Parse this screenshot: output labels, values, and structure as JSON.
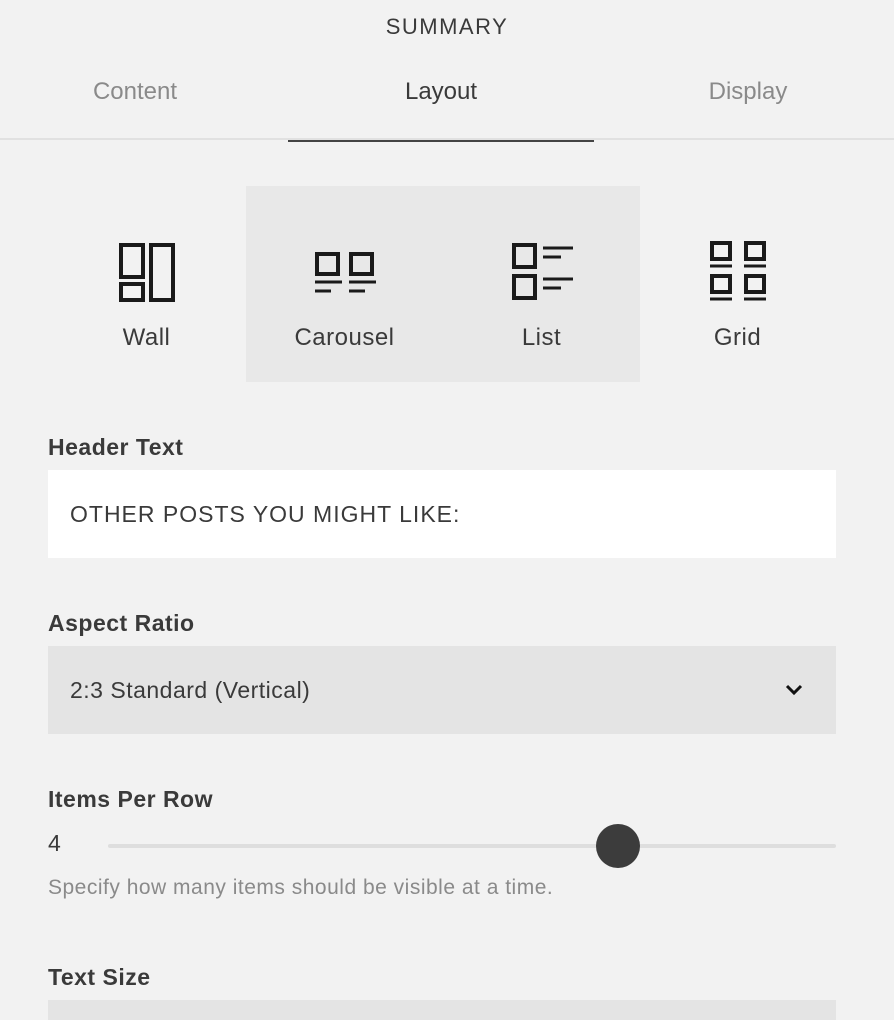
{
  "panel": {
    "title": "SUMMARY"
  },
  "tabs": [
    {
      "label": "Content",
      "active": false
    },
    {
      "label": "Layout",
      "active": true
    },
    {
      "label": "Display",
      "active": false
    }
  ],
  "layouts": [
    {
      "label": "Wall",
      "icon": "wall-layout-icon"
    },
    {
      "label": "Carousel",
      "icon": "carousel-layout-icon",
      "selected": true
    },
    {
      "label": "List",
      "icon": "list-layout-icon"
    },
    {
      "label": "Grid",
      "icon": "grid-layout-icon"
    }
  ],
  "header_text": {
    "label": "Header Text",
    "value": "OTHER POSTS YOU MIGHT LIKE:"
  },
  "aspect_ratio": {
    "label": "Aspect Ratio",
    "selected": "2:3 Standard (Vertical)",
    "icon": "chevron-down-icon"
  },
  "items_per_row": {
    "label": "Items Per Row",
    "value": "4",
    "level": 0.7,
    "help": "Specify how many items should be visible at a time."
  },
  "text_size": {
    "label": "Text Size"
  },
  "colors": {
    "background": "#f2f2f2",
    "selected": "#e8e8e8",
    "thumb": "#3c3c3c"
  }
}
